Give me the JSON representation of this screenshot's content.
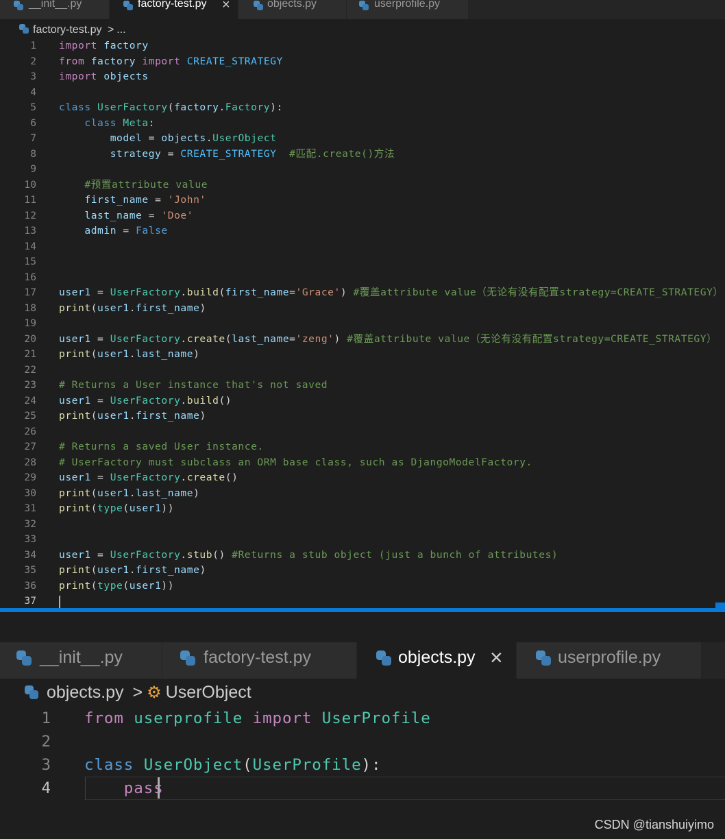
{
  "top_pane": {
    "tabs": [
      {
        "label": "__init__.py",
        "active": false
      },
      {
        "label": "factory-test.py",
        "active": true,
        "close": "×"
      },
      {
        "label": "objects.py",
        "active": false
      },
      {
        "label": "userprofile.py",
        "active": false
      }
    ],
    "breadcrumb": {
      "file": "factory-test.py",
      "sep": ">",
      "rest": "..."
    },
    "lines": [
      {
        "n": "1",
        "t": [
          [
            "kw",
            "import"
          ],
          [
            "op",
            " "
          ],
          [
            "var",
            "factory"
          ]
        ]
      },
      {
        "n": "2",
        "t": [
          [
            "kw",
            "from"
          ],
          [
            "op",
            " "
          ],
          [
            "var",
            "factory"
          ],
          [
            "op",
            " "
          ],
          [
            "kw",
            "import"
          ],
          [
            "op",
            " "
          ],
          [
            "cst",
            "CREATE_STRATEGY"
          ]
        ]
      },
      {
        "n": "3",
        "t": [
          [
            "kw",
            "import"
          ],
          [
            "op",
            " "
          ],
          [
            "var",
            "objects"
          ]
        ]
      },
      {
        "n": "4",
        "t": []
      },
      {
        "n": "5",
        "t": [
          [
            "kd",
            "class"
          ],
          [
            "op",
            " "
          ],
          [
            "cls",
            "UserFactory"
          ],
          [
            "op",
            "("
          ],
          [
            "var",
            "factory"
          ],
          [
            "op",
            "."
          ],
          [
            "cls",
            "Factory"
          ],
          [
            "op",
            "):"
          ]
        ]
      },
      {
        "n": "6",
        "t": [
          [
            "op",
            "    "
          ],
          [
            "kd",
            "class"
          ],
          [
            "op",
            " "
          ],
          [
            "cls",
            "Meta"
          ],
          [
            "op",
            ":"
          ]
        ]
      },
      {
        "n": "7",
        "t": [
          [
            "op",
            "        "
          ],
          [
            "var",
            "model"
          ],
          [
            "op",
            " = "
          ],
          [
            "var",
            "objects"
          ],
          [
            "op",
            "."
          ],
          [
            "cls",
            "UserObject"
          ]
        ]
      },
      {
        "n": "8",
        "t": [
          [
            "op",
            "        "
          ],
          [
            "var",
            "strategy"
          ],
          [
            "op",
            " = "
          ],
          [
            "cst",
            "CREATE_STRATEGY"
          ],
          [
            "op",
            "  "
          ],
          [
            "cm",
            "#匹配.create()方法"
          ]
        ]
      },
      {
        "n": "9",
        "t": []
      },
      {
        "n": "10",
        "t": [
          [
            "op",
            "    "
          ],
          [
            "cm",
            "#预置attribute value"
          ]
        ]
      },
      {
        "n": "11",
        "t": [
          [
            "op",
            "    "
          ],
          [
            "var",
            "first_name"
          ],
          [
            "op",
            " = "
          ],
          [
            "str",
            "'John'"
          ]
        ]
      },
      {
        "n": "12",
        "t": [
          [
            "op",
            "    "
          ],
          [
            "var",
            "last_name"
          ],
          [
            "op",
            " = "
          ],
          [
            "str",
            "'Doe'"
          ]
        ]
      },
      {
        "n": "13",
        "t": [
          [
            "op",
            "    "
          ],
          [
            "var",
            "admin"
          ],
          [
            "op",
            " = "
          ],
          [
            "kd",
            "False"
          ]
        ]
      },
      {
        "n": "14",
        "t": []
      },
      {
        "n": "15",
        "t": []
      },
      {
        "n": "16",
        "t": []
      },
      {
        "n": "17",
        "t": [
          [
            "var",
            "user1"
          ],
          [
            "op",
            " = "
          ],
          [
            "cls",
            "UserFactory"
          ],
          [
            "op",
            "."
          ],
          [
            "fn",
            "build"
          ],
          [
            "op",
            "("
          ],
          [
            "var",
            "first_name"
          ],
          [
            "op",
            "="
          ],
          [
            "str",
            "'Grace'"
          ],
          [
            "op",
            ") "
          ],
          [
            "cm",
            "#覆盖attribute value（无论有没有配置strategy=CREATE_STRATEGY）"
          ]
        ]
      },
      {
        "n": "18",
        "t": [
          [
            "fn",
            "print"
          ],
          [
            "op",
            "("
          ],
          [
            "var",
            "user1"
          ],
          [
            "op",
            "."
          ],
          [
            "var",
            "first_name"
          ],
          [
            "op",
            ")"
          ]
        ]
      },
      {
        "n": "19",
        "t": []
      },
      {
        "n": "20",
        "t": [
          [
            "var",
            "user1"
          ],
          [
            "op",
            " = "
          ],
          [
            "cls",
            "UserFactory"
          ],
          [
            "op",
            "."
          ],
          [
            "fn",
            "create"
          ],
          [
            "op",
            "("
          ],
          [
            "var",
            "last_name"
          ],
          [
            "op",
            "="
          ],
          [
            "str",
            "'zeng'"
          ],
          [
            "op",
            ") "
          ],
          [
            "cm",
            "#覆盖attribute value（无论有没有配置strategy=CREATE_STRATEGY）"
          ]
        ]
      },
      {
        "n": "21",
        "t": [
          [
            "fn",
            "print"
          ],
          [
            "op",
            "("
          ],
          [
            "var",
            "user1"
          ],
          [
            "op",
            "."
          ],
          [
            "var",
            "last_name"
          ],
          [
            "op",
            ")"
          ]
        ]
      },
      {
        "n": "22",
        "t": []
      },
      {
        "n": "23",
        "t": [
          [
            "cm",
            "# Returns a User instance that's not saved"
          ]
        ]
      },
      {
        "n": "24",
        "t": [
          [
            "var",
            "user1"
          ],
          [
            "op",
            " = "
          ],
          [
            "cls",
            "UserFactory"
          ],
          [
            "op",
            "."
          ],
          [
            "fn",
            "build"
          ],
          [
            "op",
            "()"
          ]
        ]
      },
      {
        "n": "25",
        "t": [
          [
            "fn",
            "print"
          ],
          [
            "op",
            "("
          ],
          [
            "var",
            "user1"
          ],
          [
            "op",
            "."
          ],
          [
            "var",
            "first_name"
          ],
          [
            "op",
            ")"
          ]
        ]
      },
      {
        "n": "26",
        "t": []
      },
      {
        "n": "27",
        "t": [
          [
            "cm",
            "# Returns a saved User instance."
          ]
        ]
      },
      {
        "n": "28",
        "t": [
          [
            "cm",
            "# UserFactory must subclass an ORM base class, such as DjangoModelFactory."
          ]
        ]
      },
      {
        "n": "29",
        "t": [
          [
            "var",
            "user1"
          ],
          [
            "op",
            " = "
          ],
          [
            "cls",
            "UserFactory"
          ],
          [
            "op",
            "."
          ],
          [
            "fn",
            "create"
          ],
          [
            "op",
            "()"
          ]
        ]
      },
      {
        "n": "30",
        "t": [
          [
            "fn",
            "print"
          ],
          [
            "op",
            "("
          ],
          [
            "var",
            "user1"
          ],
          [
            "op",
            "."
          ],
          [
            "var",
            "last_name"
          ],
          [
            "op",
            ")"
          ]
        ]
      },
      {
        "n": "31",
        "t": [
          [
            "fn",
            "print"
          ],
          [
            "op",
            "("
          ],
          [
            "cls",
            "type"
          ],
          [
            "op",
            "("
          ],
          [
            "var",
            "user1"
          ],
          [
            "op",
            "))"
          ]
        ]
      },
      {
        "n": "32",
        "t": []
      },
      {
        "n": "33",
        "t": []
      },
      {
        "n": "34",
        "t": [
          [
            "var",
            "user1"
          ],
          [
            "op",
            " = "
          ],
          [
            "cls",
            "UserFactory"
          ],
          [
            "op",
            "."
          ],
          [
            "fn",
            "stub"
          ],
          [
            "op",
            "() "
          ],
          [
            "cm",
            "#Returns a stub object (just a bunch of attributes)"
          ]
        ]
      },
      {
        "n": "35",
        "t": [
          [
            "fn",
            "print"
          ],
          [
            "op",
            "("
          ],
          [
            "var",
            "user1"
          ],
          [
            "op",
            "."
          ],
          [
            "var",
            "first_name"
          ],
          [
            "op",
            ")"
          ]
        ]
      },
      {
        "n": "36",
        "t": [
          [
            "fn",
            "print"
          ],
          [
            "op",
            "("
          ],
          [
            "cls",
            "type"
          ],
          [
            "op",
            "("
          ],
          [
            "var",
            "user1"
          ],
          [
            "op",
            "))"
          ]
        ]
      },
      {
        "n": "37",
        "t": []
      }
    ]
  },
  "bottom_pane": {
    "tabs": [
      {
        "label": "__init__.py",
        "active": false
      },
      {
        "label": "factory-test.py",
        "active": false
      },
      {
        "label": "objects.py",
        "active": true,
        "close": "×"
      },
      {
        "label": "userprofile.py",
        "active": false
      }
    ],
    "breadcrumb": {
      "file": "objects.py",
      "sep": ">",
      "symbol": "UserObject"
    },
    "lines": [
      {
        "n": "1",
        "t": [
          [
            "kw",
            "from"
          ],
          [
            "op",
            " "
          ],
          [
            "cls",
            "userprofile"
          ],
          [
            "op",
            " "
          ],
          [
            "kw",
            "import"
          ],
          [
            "op",
            " "
          ],
          [
            "cls",
            "UserProfile"
          ]
        ]
      },
      {
        "n": "2",
        "t": []
      },
      {
        "n": "3",
        "t": [
          [
            "kd",
            "class"
          ],
          [
            "op",
            " "
          ],
          [
            "cls",
            "UserObject"
          ],
          [
            "op",
            "("
          ],
          [
            "cls",
            "UserProfile"
          ],
          [
            "op",
            "):"
          ]
        ]
      },
      {
        "n": "4",
        "t": [
          [
            "op",
            "    "
          ],
          [
            "kw",
            "pass"
          ]
        ]
      }
    ]
  },
  "watermark": "CSDN @tianshuiyimo",
  "colors": {
    "accent": "#0a78d6",
    "background": "#1e1e1e",
    "python_icon": "#4b8bbe"
  }
}
